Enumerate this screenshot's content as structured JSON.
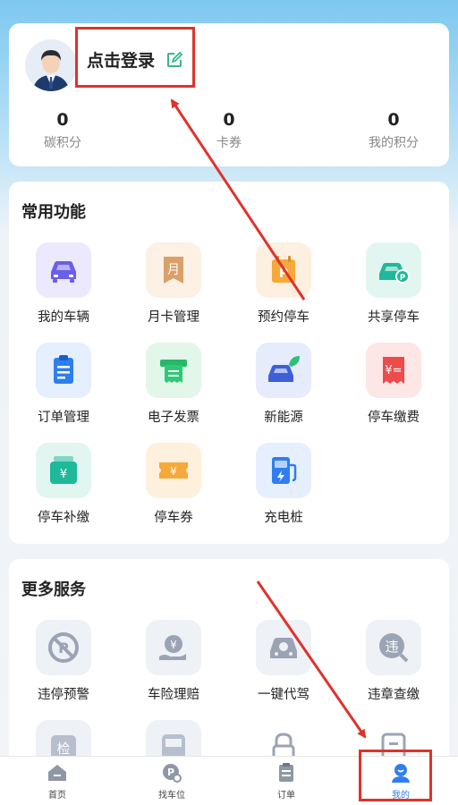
{
  "profile": {
    "login_label": "点击登录",
    "stats": [
      {
        "value": "0",
        "label": "碳积分"
      },
      {
        "value": "0",
        "label": "卡券"
      },
      {
        "value": "0",
        "label": "我的积分"
      }
    ]
  },
  "functions": {
    "title": "常用功能",
    "items": [
      {
        "label": "我的车辆",
        "icon": "car-icon"
      },
      {
        "label": "月卡管理",
        "icon": "month-card-icon"
      },
      {
        "label": "预约停车",
        "icon": "reserve-parking-icon"
      },
      {
        "label": "共享停车",
        "icon": "shared-parking-icon"
      },
      {
        "label": "订单管理",
        "icon": "order-icon"
      },
      {
        "label": "电子发票",
        "icon": "invoice-icon"
      },
      {
        "label": "新能源",
        "icon": "new-energy-icon"
      },
      {
        "label": "停车缴费",
        "icon": "parking-fee-icon"
      },
      {
        "label": "停车补缴",
        "icon": "parking-repay-icon"
      },
      {
        "label": "停车券",
        "icon": "parking-coupon-icon"
      },
      {
        "label": "充电桩",
        "icon": "charging-pile-icon"
      }
    ]
  },
  "services": {
    "title": "更多服务",
    "items": [
      {
        "label": "违停预警",
        "icon": "no-parking-icon"
      },
      {
        "label": "车险理赔",
        "icon": "insurance-icon"
      },
      {
        "label": "一键代驾",
        "icon": "designated-driver-icon"
      },
      {
        "label": "违章查缴",
        "icon": "violation-icon"
      },
      {
        "label": "",
        "icon": "inspection-icon"
      },
      {
        "label": "",
        "icon": "bus-icon"
      },
      {
        "label": "",
        "icon": "lock-icon"
      },
      {
        "label": "",
        "icon": "document-icon"
      }
    ]
  },
  "tabbar": {
    "tabs": [
      {
        "label": "首页",
        "icon": "home-icon"
      },
      {
        "label": "找车位",
        "icon": "find-parking-icon"
      },
      {
        "label": "订单",
        "icon": "order-tab-icon"
      },
      {
        "label": "我的",
        "icon": "profile-icon"
      }
    ],
    "active_index": 3
  },
  "colors": {
    "accent": "#2f7ef0",
    "annotation": "#e0322b"
  }
}
